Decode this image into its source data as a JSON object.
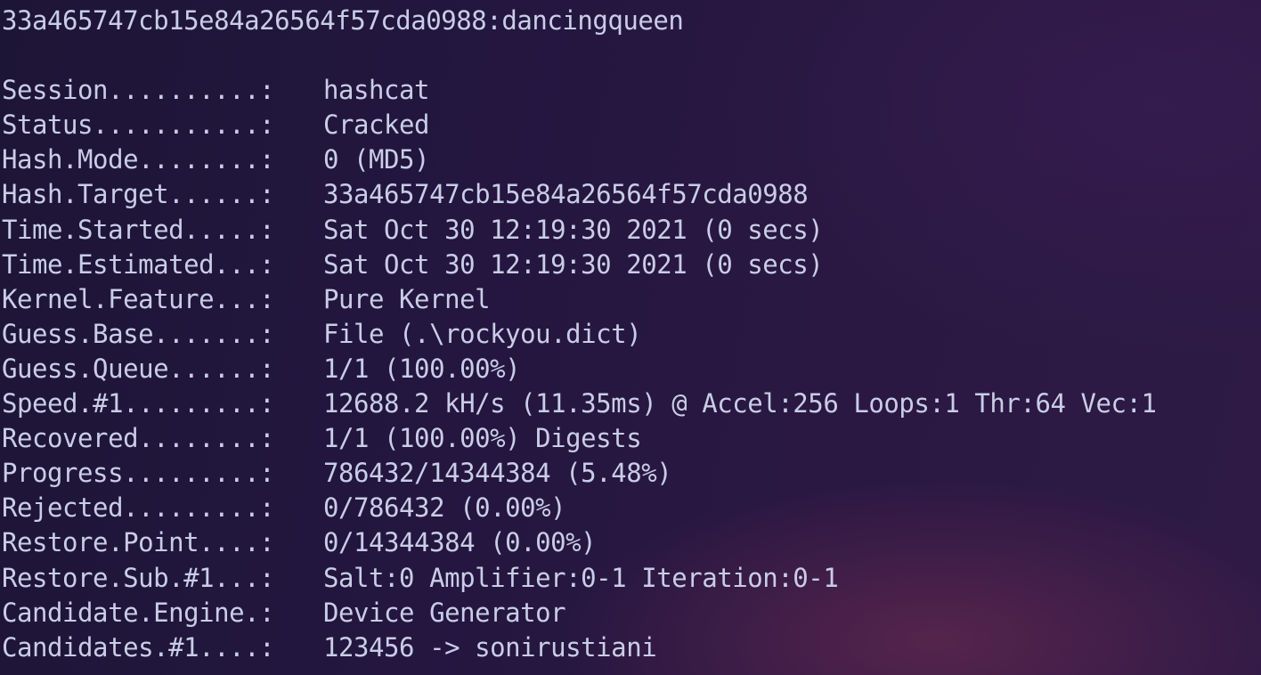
{
  "terminal": {
    "cracked_line": "33a465747cb15e84a26564f57cda0988:dancingqueen",
    "fields": [
      {
        "key": "Session..........:",
        "value": "hashcat"
      },
      {
        "key": "Status...........:",
        "value": "Cracked"
      },
      {
        "key": "Hash.Mode........:",
        "value": "0 (MD5)"
      },
      {
        "key": "Hash.Target......:",
        "value": "33a465747cb15e84a26564f57cda0988"
      },
      {
        "key": "Time.Started.....:",
        "value": "Sat Oct 30 12:19:30 2021 (0 secs)"
      },
      {
        "key": "Time.Estimated...:",
        "value": "Sat Oct 30 12:19:30 2021 (0 secs)"
      },
      {
        "key": "Kernel.Feature...:",
        "value": "Pure Kernel"
      },
      {
        "key": "Guess.Base.......:",
        "value": "File (.\\rockyou.dict)"
      },
      {
        "key": "Guess.Queue......:",
        "value": "1/1 (100.00%)"
      },
      {
        "key": "Speed.#1.........:",
        "value": "12688.2 kH/s (11.35ms) @ Accel:256 Loops:1 Thr:64 Vec:1"
      },
      {
        "key": "Recovered........:",
        "value": "1/1 (100.00%) Digests"
      },
      {
        "key": "Progress.........:",
        "value": "786432/14344384 (5.48%)"
      },
      {
        "key": "Rejected.........:",
        "value": "0/786432 (0.00%)"
      },
      {
        "key": "Restore.Point....:",
        "value": "0/14344384 (0.00%)"
      },
      {
        "key": "Restore.Sub.#1...:",
        "value": "Salt:0 Amplifier:0-1 Iteration:0-1"
      },
      {
        "key": "Candidate.Engine.:",
        "value": "Device Generator"
      },
      {
        "key": "Candidates.#1....:",
        "value": "123456 -> sonirustiani"
      }
    ]
  }
}
